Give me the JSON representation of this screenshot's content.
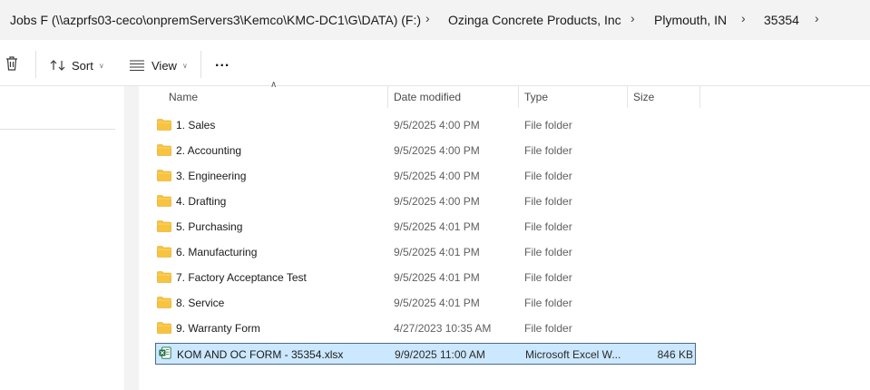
{
  "breadcrumb": {
    "items": [
      "Jobs F (\\\\azprfs03-ceco\\onpremServers3\\Kemco\\KMC-DC1\\G\\DATA) (F:)",
      "Ozinga Concrete Products, Inc",
      "Plymouth, IN",
      "35354"
    ],
    "separator": ">"
  },
  "toolbar": {
    "sort_label": "Sort",
    "view_label": "View",
    "more_label": "..."
  },
  "columns": {
    "name": "Name",
    "date": "Date modified",
    "type": "Type",
    "size": "Size"
  },
  "files": [
    {
      "name": "1. Sales",
      "date": "9/5/2025 4:00 PM",
      "type": "File folder",
      "size": "",
      "icon": "folder-icon"
    },
    {
      "name": "2. Accounting",
      "date": "9/5/2025 4:00 PM",
      "type": "File folder",
      "size": "",
      "icon": "folder-icon"
    },
    {
      "name": "3. Engineering",
      "date": "9/5/2025 4:00 PM",
      "type": "File folder",
      "size": "",
      "icon": "folder-icon"
    },
    {
      "name": "4. Drafting",
      "date": "9/5/2025 4:00 PM",
      "type": "File folder",
      "size": "",
      "icon": "folder-icon"
    },
    {
      "name": "5. Purchasing",
      "date": "9/5/2025 4:01 PM",
      "type": "File folder",
      "size": "",
      "icon": "folder-icon"
    },
    {
      "name": "6. Manufacturing",
      "date": "9/5/2025 4:01 PM",
      "type": "File folder",
      "size": "",
      "icon": "folder-icon"
    },
    {
      "name": "7. Factory Acceptance Test",
      "date": "9/5/2025 4:01 PM",
      "type": "File folder",
      "size": "",
      "icon": "folder-icon"
    },
    {
      "name": "8. Service",
      "date": "9/5/2025 4:01 PM",
      "type": "File folder",
      "size": "",
      "icon": "folder-icon"
    },
    {
      "name": "9. Warranty Form",
      "date": "4/27/2023 10:35 AM",
      "type": "File folder",
      "size": "",
      "icon": "folder-icon"
    },
    {
      "name": "KOM AND OC FORM - 35354.xlsx",
      "date": "9/9/2025 11:00 AM",
      "type": "Microsoft Excel W...",
      "size": "846 KB",
      "icon": "excel-file-icon"
    }
  ],
  "colors": {
    "folder": "#f8c33f",
    "excel": "#1d6f42",
    "selection": "#cce8ff"
  }
}
